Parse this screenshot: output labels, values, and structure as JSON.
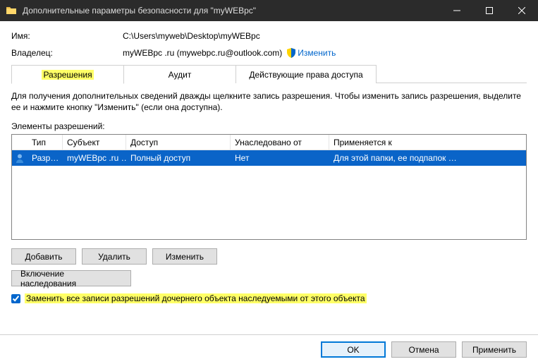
{
  "window": {
    "title": "Дополнительные параметры безопасности  для \"myWEBpc\""
  },
  "info": {
    "name_label": "Имя:",
    "name_value": "C:\\Users\\myweb\\Desktop\\myWEBpc",
    "owner_label": "Владелец:",
    "owner_value": "myWEBpc .ru (mywebpc.ru@outlook.com)",
    "change_link": "Изменить"
  },
  "tabs": {
    "permissions": "Разрешения",
    "audit": "Аудит",
    "effective": "Действующие права доступа"
  },
  "body": {
    "description": "Для получения дополнительных сведений дважды щелкните запись разрешения. Чтобы изменить запись разрешения, выделите ее и нажмите кнопку \"Изменить\" (если она доступна).",
    "elements_label": "Элементы разрешений:"
  },
  "grid": {
    "headers": {
      "type": "Тип",
      "subject": "Субъект",
      "access": "Доступ",
      "inherited": "Унаследовано от",
      "applies": "Применяется к"
    },
    "rows": [
      {
        "type": "Разр…",
        "subject": "myWEBpc .ru …",
        "access": "Полный доступ",
        "inherited": "Нет",
        "applies": "Для этой папки, ее подпапок …"
      }
    ]
  },
  "buttons": {
    "add": "Добавить",
    "remove": "Удалить",
    "edit": "Изменить",
    "enable_inherit": "Включение наследования",
    "ok": "OK",
    "cancel": "Отмена",
    "apply": "Применить"
  },
  "checkbox": {
    "replace_label": "Заменить все записи разрешений дочернего объекта наследуемыми от этого объекта"
  }
}
